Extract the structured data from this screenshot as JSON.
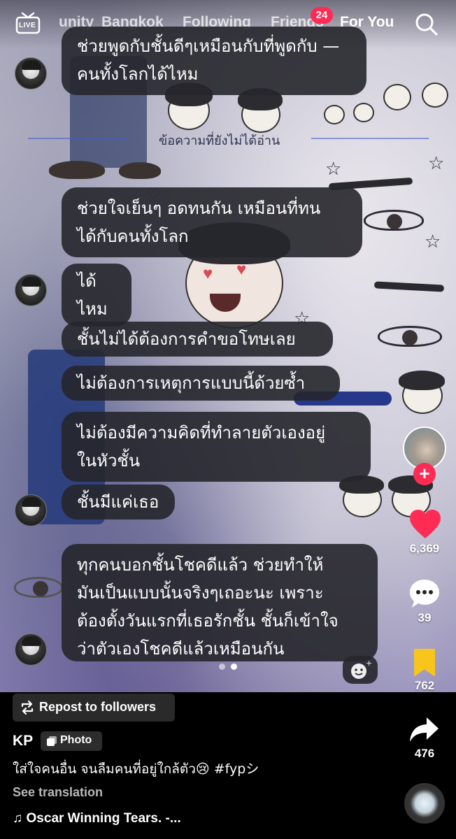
{
  "topnav": {
    "live_label": "LIVE",
    "tabs": [
      {
        "label": "unity"
      },
      {
        "label": "Bangkok"
      },
      {
        "label": "Following"
      },
      {
        "label": "Friends"
      },
      {
        "label": "For You"
      }
    ],
    "friends_badge": "24",
    "search_icon": "search-icon"
  },
  "chat": {
    "unread_label": "ข้อความที่ยังไม่ได้อ่าน",
    "messages": [
      {
        "line1": "ช่วยพูดกับชั้นดีๆเหมือนกับที่พูดกับ —",
        "line2": "คนทั้งโลกได้ไหม"
      },
      {
        "line1": "ช่วยใจเย็นๆ อดทนกัน เหมือนที่ทน",
        "line2": "ได้กับคนทั้งโลก"
      },
      {
        "line1": "ได้ไหม"
      },
      {
        "line1": "ชั้นไม่ได้ต้องการคำขอโทษเลย"
      },
      {
        "line1": "ไม่ต้องการเหตุการแบบนี้ด้วยซ้ำ"
      },
      {
        "line1": "ไม่ต้องมีความคิดที่ทำลายตัวเองอยู่",
        "line2": "ในหัวชั้น"
      },
      {
        "line1": "ชั้นมีแค่เธอ"
      },
      {
        "line1": "ทุกคนบอกชั้นโชคดีแล้ว ช่วยทำให้",
        "line2": "มันเป็นแบบนั้นจริงๆเถอะนะ เพราะ",
        "line3": "ต้องตั้งวันแรกที่เธอรักชั้น ชั้นก็เข้าใจ",
        "line4": "ว่าตัวเองโชคดีแล้วเหมือนกัน"
      }
    ]
  },
  "rail": {
    "likes": "6,369",
    "comments": "39",
    "saves": "762",
    "shares": "476",
    "colors": {
      "like": "#fe2c55",
      "save": "#f8c51c"
    }
  },
  "info": {
    "repost_label": "Repost to followers",
    "author": "KP",
    "photo_label": "Photo",
    "caption": "ใส่ใจคนอื่น จนลืมคนที่อยู่ใกล้ตัว😢 #fypシ",
    "see_translation": "See translation",
    "music": "♫ Oscar Winning Tears. -..."
  },
  "carousel": {
    "total": 2,
    "current": 2
  }
}
